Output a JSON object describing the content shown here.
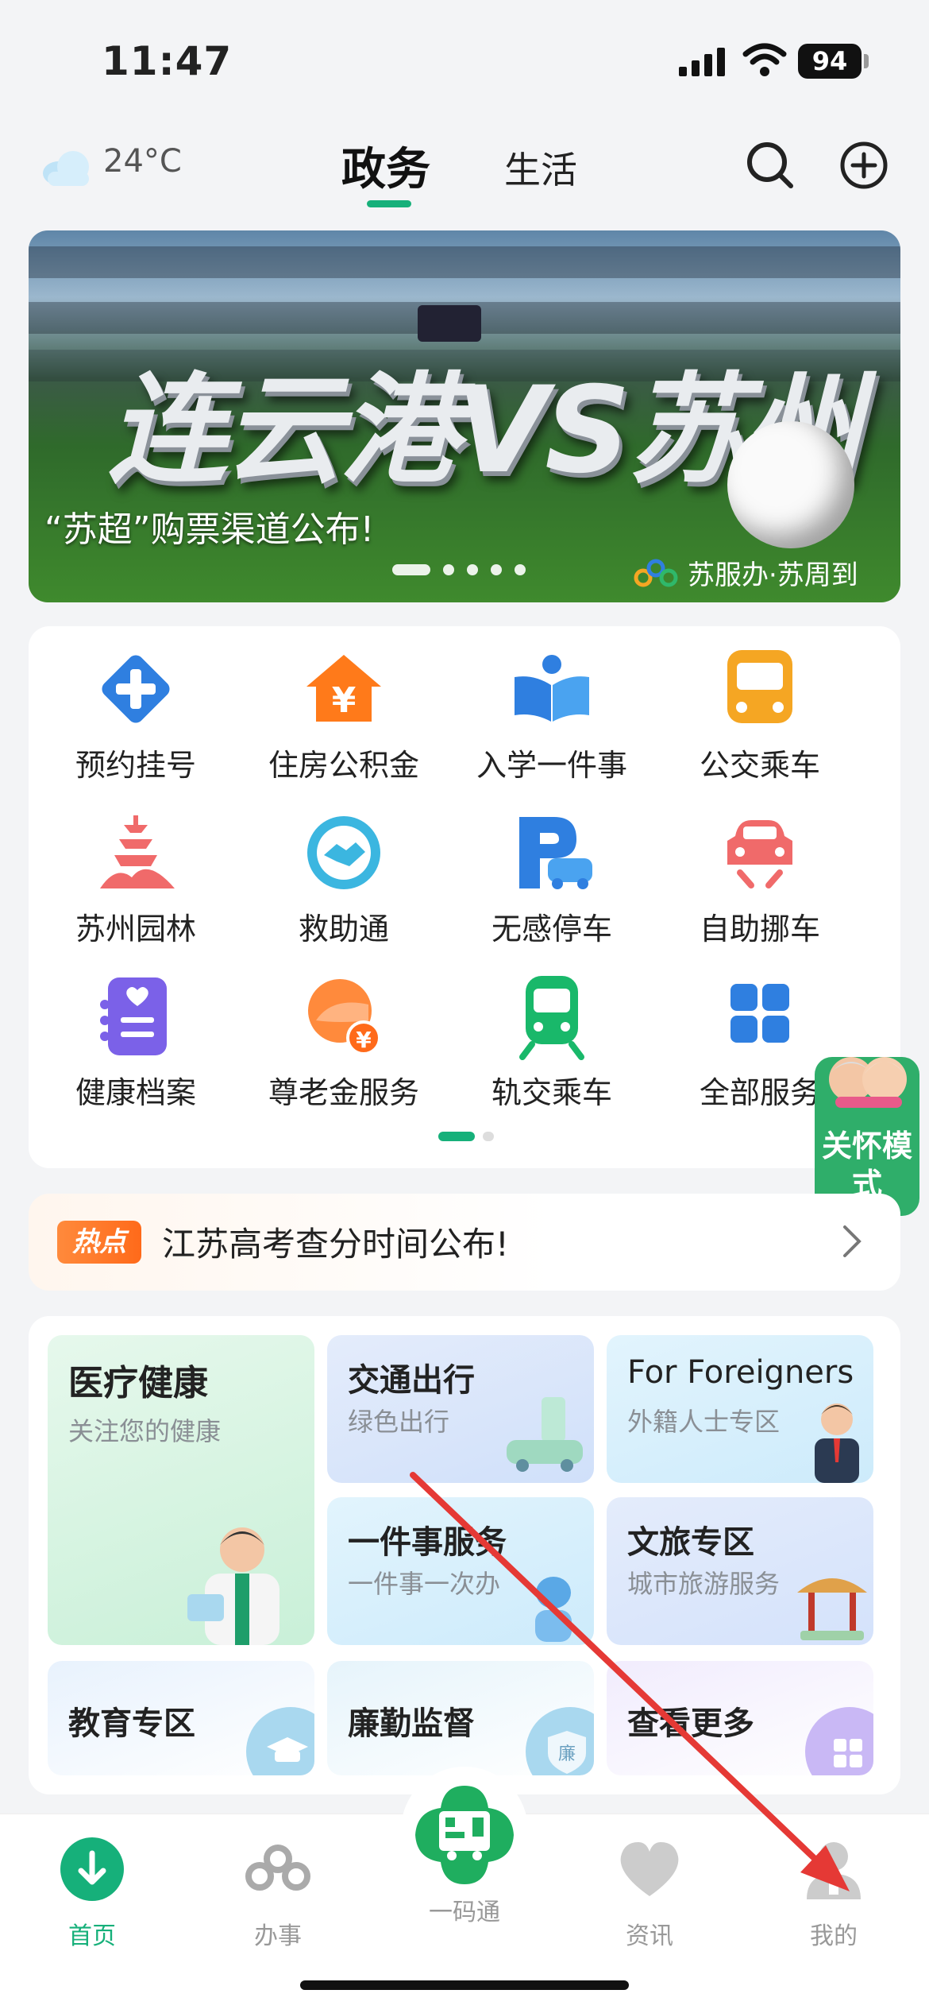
{
  "status_bar": {
    "time": "11:47",
    "battery": "94"
  },
  "header": {
    "weather": "24°C",
    "tabs": [
      {
        "label": "政务",
        "active": true
      },
      {
        "label": "生活",
        "active": false
      }
    ]
  },
  "banner": {
    "title": "连云港VS苏州",
    "caption": "“苏超”购票渠道公布!",
    "brand": "苏服办·苏周到",
    "slides": 5,
    "active_slide": 1
  },
  "services": [
    {
      "label": "预约挂号",
      "icon": "medical-cross-icon"
    },
    {
      "label": "住房公积金",
      "icon": "house-yuan-icon"
    },
    {
      "label": "入学一件事",
      "icon": "open-book-icon"
    },
    {
      "label": "公交乘车",
      "icon": "bus-icon"
    },
    {
      "label": "苏州园林",
      "icon": "pagoda-icon"
    },
    {
      "label": "救助通",
      "icon": "handshake-icon"
    },
    {
      "label": "无感停车",
      "icon": "parking-car-icon"
    },
    {
      "label": "自助挪车",
      "icon": "car-move-icon"
    },
    {
      "label": "健康档案",
      "icon": "health-record-icon"
    },
    {
      "label": "尊老金服务",
      "icon": "elder-fund-icon"
    },
    {
      "label": "轨交乘车",
      "icon": "metro-train-icon"
    },
    {
      "label": "全部服务",
      "icon": "grid-icon"
    }
  ],
  "care_mode": {
    "label": "关怀模式"
  },
  "hot": {
    "tag": "热点",
    "text": "江苏高考查分时间公布!"
  },
  "topics": {
    "medical": {
      "title": "医疗健康",
      "subtitle": "关注您的健康"
    },
    "traffic": {
      "title": "交通出行",
      "subtitle": "绿色出行"
    },
    "foreigners": {
      "title": "For Foreigners",
      "subtitle": "外籍人士专区"
    },
    "one_thing": {
      "title": "一件事服务",
      "subtitle": "一件事一次办"
    },
    "culture": {
      "title": "文旅专区",
      "subtitle": "城市旅游服务"
    },
    "education": {
      "title": "教育专区",
      "badge": ""
    },
    "integrity": {
      "title": "廉勤监督",
      "badge": "廉"
    },
    "more": {
      "title": "查看更多"
    }
  },
  "bottom_nav": [
    {
      "label": "首页",
      "icon": "home-download-icon",
      "active": true
    },
    {
      "label": "办事",
      "icon": "service-logo-icon",
      "active": false
    },
    {
      "label": "一码通",
      "icon": "qr-code-icon",
      "active": false
    },
    {
      "label": "资讯",
      "icon": "heart-icon",
      "active": false
    },
    {
      "label": "我的",
      "icon": "person-icon",
      "active": false
    }
  ],
  "colors": {
    "accent": "#16b07a",
    "hot": "#ff6a1a",
    "annotation": "#e53935"
  }
}
